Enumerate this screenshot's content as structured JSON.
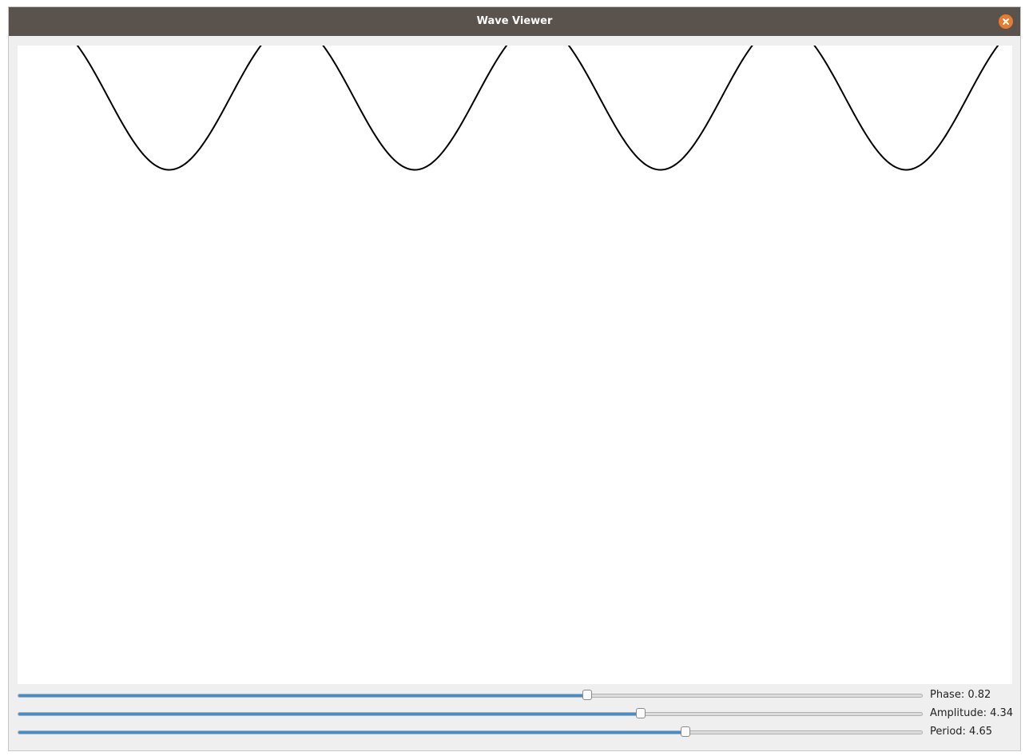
{
  "window": {
    "title": "Wave Viewer",
    "close_icon": "close-icon"
  },
  "plot": {
    "phase": 0.82,
    "amplitude": 4.34,
    "period": 4.65,
    "line_color": "#000000"
  },
  "sliders": [
    {
      "name": "phase",
      "label": "Phase: 0.82",
      "fraction": 0.629
    },
    {
      "name": "amplitude",
      "label": "Amplitude: 4.34",
      "fraction": 0.688
    },
    {
      "name": "period",
      "label": "Period: 4.65",
      "fraction": 0.738
    }
  ],
  "colors": {
    "titlebar": "#5a524c",
    "close": "#ea7b2e",
    "slider_fill": "#3d8fd1"
  }
}
